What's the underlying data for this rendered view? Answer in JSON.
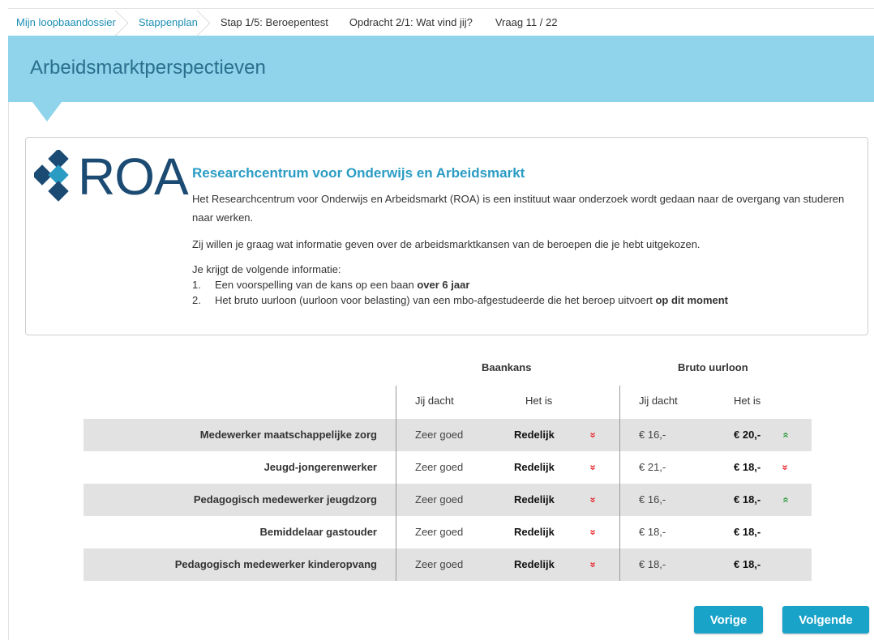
{
  "breadcrumb": {
    "items": [
      {
        "label": "Mijn loopbaandossier"
      },
      {
        "label": "Stappenplan"
      },
      {
        "label": "Stap 1/5: Beroepentest"
      },
      {
        "label": "Opdracht 2/1: Wat vind jij?"
      },
      {
        "label": "Vraag 11 / 22"
      }
    ]
  },
  "header": {
    "title": "Arbeidsmarktperspectieven"
  },
  "colors": {
    "banner": "#8fd4ea",
    "accent": "#1aa3c9",
    "logo": "#1b4a73",
    "down": "#e8262c",
    "up": "#2e9b3e"
  },
  "info": {
    "logo_text": "ROA",
    "title": "Researchcentrum voor Onderwijs en Arbeidsmarkt",
    "para1": "Het Researchcentrum voor Onderwijs en Arbeidsmarkt (ROA) is een instituut waar onderzoek wordt gedaan naar de overgang van studeren naar werken.",
    "para2": "Zij willen je graag wat informatie geven over de arbeidsmarktkansen van de beroepen die je hebt uitgekozen.",
    "list_intro": "Je krijgt de volgende informatie:",
    "list": [
      {
        "num": "1.",
        "text": "Een voorspelling van de kans op een baan ",
        "bold": "over 6 jaar"
      },
      {
        "num": "2.",
        "text": "Het bruto uurloon (uurloon voor belasting) van een mbo-afgestudeerde die het beroep uitvoert ",
        "bold": "op dit moment"
      }
    ]
  },
  "table": {
    "group1": "Baankans",
    "group2": "Bruto uurloon",
    "col_thought": "Jij dacht",
    "col_actual": "Het is",
    "rows": [
      {
        "name": "Medewerker maatschappelijke zorg",
        "kans_dacht": "Zeer goed",
        "kans_is": "Redelijk",
        "kans_trend": "down",
        "loon_dacht": "€ 16,-",
        "loon_is": "€ 20,-",
        "loon_trend": "up"
      },
      {
        "name": "Jeugd-jongerenwerker",
        "kans_dacht": "Zeer goed",
        "kans_is": "Redelijk",
        "kans_trend": "down",
        "loon_dacht": "€ 21,-",
        "loon_is": "€ 18,-",
        "loon_trend": "down"
      },
      {
        "name": "Pedagogisch medewerker jeugdzorg",
        "kans_dacht": "Zeer goed",
        "kans_is": "Redelijk",
        "kans_trend": "down",
        "loon_dacht": "€ 16,-",
        "loon_is": "€ 18,-",
        "loon_trend": "up"
      },
      {
        "name": "Bemiddelaar gastouder",
        "kans_dacht": "Zeer goed",
        "kans_is": "Redelijk",
        "kans_trend": "down",
        "loon_dacht": "€ 18,-",
        "loon_is": "€ 18,-",
        "loon_trend": "none"
      },
      {
        "name": "Pedagogisch medewerker kinderopvang",
        "kans_dacht": "Zeer goed",
        "kans_is": "Redelijk",
        "kans_trend": "down",
        "loon_dacht": "€ 18,-",
        "loon_is": "€ 18,-",
        "loon_trend": "none"
      }
    ]
  },
  "buttons": {
    "prev": "Vorige",
    "next": "Volgende"
  }
}
